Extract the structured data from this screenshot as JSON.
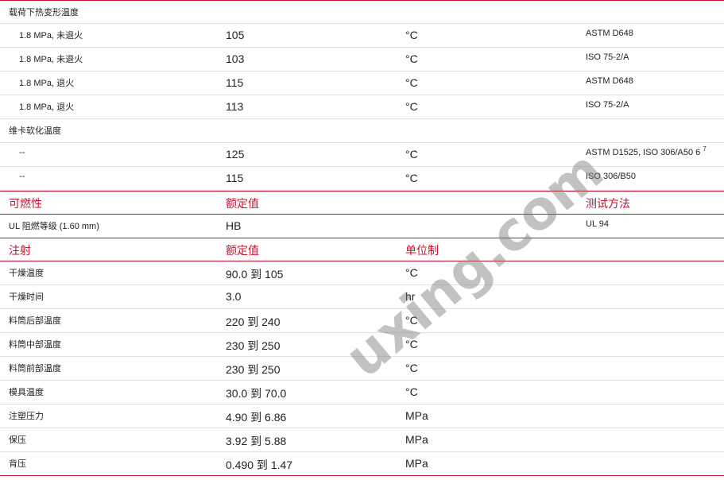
{
  "hdt": {
    "title": "载荷下热变形温度",
    "rows": [
      {
        "cond": "1.8 MPa, 未退火",
        "value": "105",
        "unit": "°C",
        "method": "ASTM D648"
      },
      {
        "cond": "1.8 MPa, 未退火",
        "value": "103",
        "unit": "°C",
        "method": "ISO 75-2/A"
      },
      {
        "cond": "1.8 MPa, 退火",
        "value": "115",
        "unit": "°C",
        "method": "ASTM D648"
      },
      {
        "cond": "1.8 MPa, 退火",
        "value": "113",
        "unit": "°C",
        "method": "ISO 75-2/A"
      }
    ]
  },
  "vicat": {
    "title": "维卡软化温度",
    "rows": [
      {
        "cond": "--",
        "value": "125",
        "unit": "°C",
        "method": "ASTM D1525, ISO 306/A50 6",
        "note": "7"
      },
      {
        "cond": "--",
        "value": "115",
        "unit": "°C",
        "method": "ISO 306/B50"
      }
    ]
  },
  "flammability": {
    "header": {
      "col1": "可燃性",
      "col2": "额定值",
      "col4": "测试方法"
    },
    "rows": [
      {
        "name": "UL 阻燃等级 (1.60 mm)",
        "value": "HB",
        "method": "UL 94"
      }
    ]
  },
  "injection": {
    "header": {
      "col1": "注射",
      "col2": "额定值",
      "col3": "单位制"
    },
    "rows": [
      {
        "name": "干燥温度",
        "value": "90.0 到 105",
        "unit": "°C"
      },
      {
        "name": "干燥时间",
        "value": "3.0",
        "unit": "hr"
      },
      {
        "name": "料筒后部温度",
        "value": "220 到 240",
        "unit": "°C"
      },
      {
        "name": "料筒中部温度",
        "value": "230 到 250",
        "unit": "°C"
      },
      {
        "name": "料筒前部温度",
        "value": "230 到 250",
        "unit": "°C"
      },
      {
        "name": "模具温度",
        "value": "30.0 到 70.0",
        "unit": "°C"
      },
      {
        "name": "注塑压力",
        "value": "4.90 到 6.86",
        "unit": "MPa"
      },
      {
        "name": "保压",
        "value": "3.92 到 5.88",
        "unit": "MPa"
      },
      {
        "name": "背压",
        "value": "0.490 到 1.47",
        "unit": "MPa"
      }
    ]
  },
  "watermark": "uxing.com"
}
